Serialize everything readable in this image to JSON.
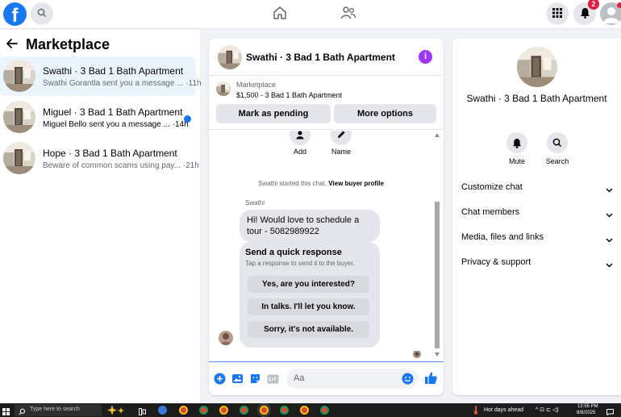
{
  "colors": {
    "brand": "#1877f2",
    "badge": "#e41e3f",
    "info": "#a033ff"
  },
  "topbar": {
    "logo_glyph": "f",
    "icons": [
      "search-icon",
      "home-icon",
      "people-icon",
      "grid-menu-icon",
      "bell-icon",
      "profile-avatar"
    ],
    "notifications_count": "2"
  },
  "sidebar": {
    "title": "Marketplace",
    "conversations": [
      {
        "title": "Swathi · 3 Bad 1 Bath Apartment",
        "preview": "Swathi Gorantla sent you a message ... ·11h",
        "active": true,
        "unread": false
      },
      {
        "title": "Miguel · 3 Bad 1 Bath Apartment",
        "preview": "Miguel Bello sent you a message ... ·14h",
        "active": false,
        "unread": true
      },
      {
        "title": "Hope · 3 Bad 1 Bath Apartment",
        "preview": "Beware of common scams using pay... ·21h",
        "active": false,
        "unread": false
      }
    ]
  },
  "chat": {
    "header_title": "Swathi · 3 Bad 1 Bath Apartment",
    "info_glyph": "i",
    "listing": {
      "category": "Marketplace",
      "price_title": "$1,500 - 3 Bad 1 Bath Apartment",
      "pending_button": "Mark as pending",
      "more_button": "More options"
    },
    "actions": [
      {
        "label": "Add",
        "icon": "add-person-icon"
      },
      {
        "label": "Name",
        "icon": "pencil-icon"
      }
    ],
    "system_prefix": "Swathi started this chat.",
    "system_link": "View buyer profile",
    "sender": "Swathi",
    "message": "Hi! Would love to schedule a tour - 5082989922",
    "quick_title": "Send a quick response",
    "quick_subtitle": "Tap a response to send it to the buyer.",
    "quick_responses": [
      "Yes, are you interested?",
      "In talks. I'll let you know.",
      "Sorry, it's not available."
    ],
    "composer_placeholder": "Aa"
  },
  "info_panel": {
    "name": "Swathi · 3 Bad 1 Bath Apartment",
    "actions": [
      {
        "label": "Mute",
        "icon": "bell-icon"
      },
      {
        "label": "Search",
        "icon": "search-icon"
      }
    ],
    "sections": [
      "Customize chat",
      "Chat members",
      "Media, files and links",
      "Privacy & support"
    ]
  },
  "taskbar": {
    "search_placeholder": "Type here to search",
    "weather": "Hot days ahead",
    "time": "12:55 PM",
    "date": "8/8/2025"
  }
}
